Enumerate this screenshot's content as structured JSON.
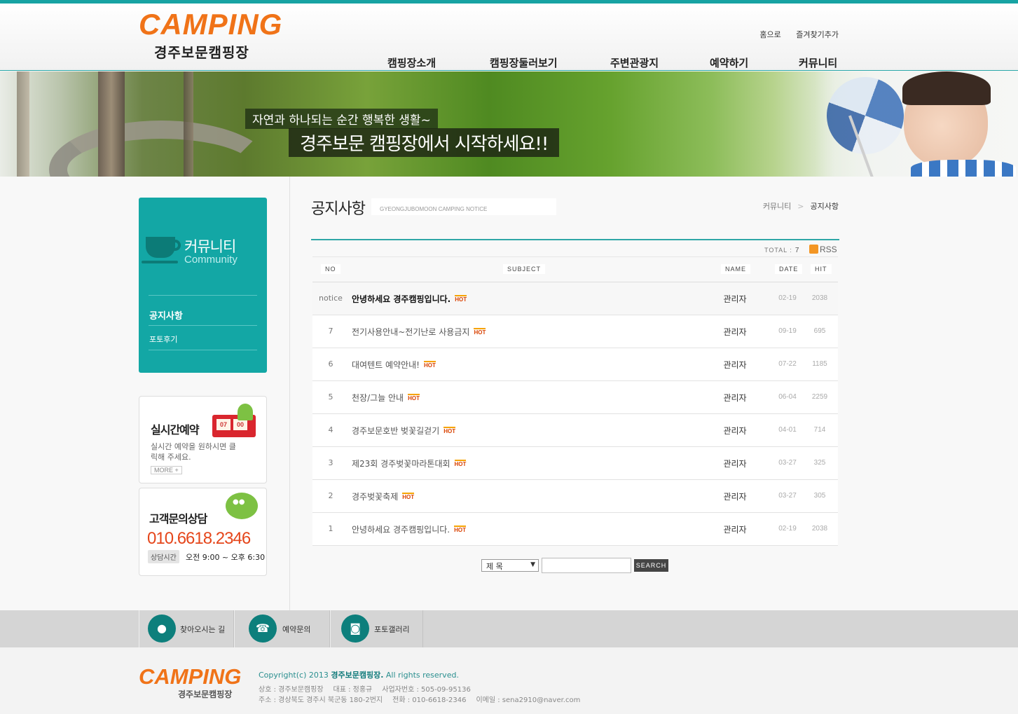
{
  "site": {
    "logo_word": "CAMPING",
    "logo_name": "경주보문캠핑장"
  },
  "util_links": [
    "홈으로",
    "즐겨찾기추가"
  ],
  "gnb": [
    "캠핑장소개",
    "캠핑장둘러보기",
    "주변관광지",
    "예약하기",
    "커뮤니티"
  ],
  "banner": {
    "line1": "자연과 하나되는 순간 행복한 생활~",
    "line2": "경주보문 캠핑장에서 시작하세요!!"
  },
  "lnb": {
    "title": "커뮤니티",
    "subtitle": "Community",
    "items": [
      "공지사항",
      "포토후기"
    ]
  },
  "reserve_box": {
    "title": "실시간예약",
    "desc": "실시간 예약을 원하시면 클릭해 주세요.",
    "more": "MORE +",
    "clock": [
      "07",
      "00"
    ]
  },
  "cs_box": {
    "title": "고객문의상담",
    "phone": "010.6618.2346",
    "hours_label": "상담시간",
    "hours": "오전 9:00 ~ 오후 6:30"
  },
  "page": {
    "title": "공지사항",
    "eng": "GYEONGJUBOMOON CAMPING NOTICE",
    "breadcrumb": [
      "커뮤니티",
      "공지사항"
    ]
  },
  "board": {
    "total_label": "TOTAL :",
    "total": "7",
    "rss": "RSS",
    "columns": [
      "NO",
      "SUBJECT",
      "NAME",
      "DATE",
      "HIT"
    ],
    "hot_label": "HOT",
    "rows": [
      {
        "no": "notice",
        "subject": "안녕하세요 경주캠핑입니다.",
        "name": "관리자",
        "date": "02-19",
        "hit": "2038"
      },
      {
        "no": "7",
        "subject": "전기사용안내~전기난로 사용금지",
        "name": "관리자",
        "date": "09-19",
        "hit": "695"
      },
      {
        "no": "6",
        "subject": "대여텐트 예약안내!",
        "name": "관리자",
        "date": "07-22",
        "hit": "1185"
      },
      {
        "no": "5",
        "subject": "천장/그늘 안내",
        "name": "관리자",
        "date": "06-04",
        "hit": "2259"
      },
      {
        "no": "4",
        "subject": "경주보문호반 벚꽃길걷기",
        "name": "관리자",
        "date": "04-01",
        "hit": "714"
      },
      {
        "no": "3",
        "subject": "제23회 경주벚꽃마라톤대회",
        "name": "관리자",
        "date": "03-27",
        "hit": "325"
      },
      {
        "no": "2",
        "subject": "경주벚꽃축제",
        "name": "관리자",
        "date": "03-27",
        "hit": "305"
      },
      {
        "no": "1",
        "subject": "안녕하세요 경주캠핑입니다.",
        "name": "관리자",
        "date": "02-19",
        "hit": "2038"
      }
    ]
  },
  "search": {
    "select_value": "제 목",
    "input_value": "",
    "button": "SEARCH"
  },
  "quick_links": [
    "찾아오시는 길",
    "예약문의",
    "포토갤러리"
  ],
  "footer": {
    "logo_word": "CAMPING",
    "logo_name": "경주보문캠핑장",
    "copyright_prefix": "Copyright(c) 2013 ",
    "copyright_name": "경주보문캠핑장.",
    "copyright_suffix": " All rights reserved.",
    "line1": [
      "상호 : 경주보문캠핑장",
      "대표 : 정홍규",
      "사업자번호 : 505-09-95136"
    ],
    "line2": [
      "주소 : 경상북도 경주시 북군동 180-2번지",
      "전화 : 010-6618-2346",
      "이메일 : sena2910@naver.com"
    ]
  },
  "colors": {
    "accent": "#17a3a3",
    "logo_orange": "#f07318",
    "hot_red": "#d94100",
    "phone_red": "#e5461b"
  }
}
